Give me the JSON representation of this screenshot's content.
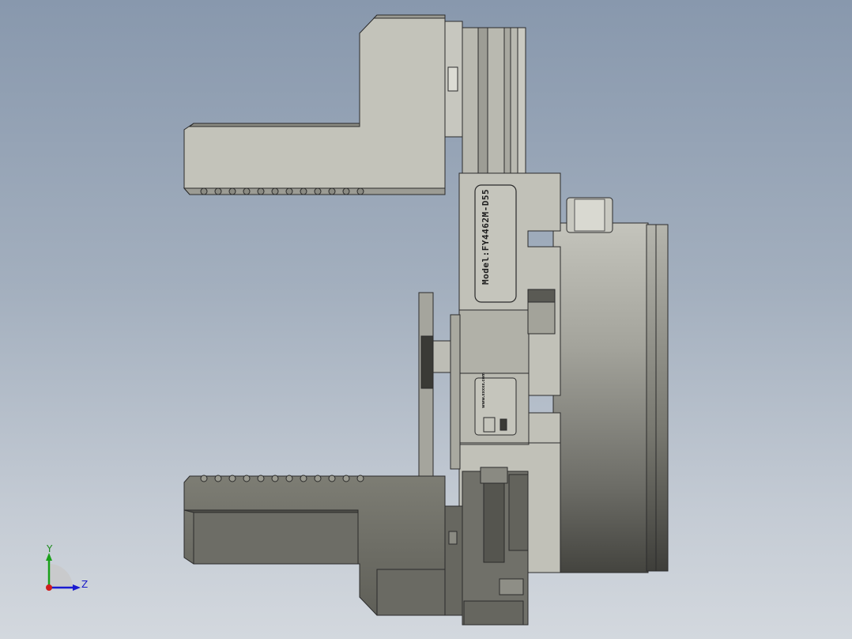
{
  "viewport": {
    "model_label": "Model:FY4462M-D55",
    "brand_url": "www.xxxxx.com"
  },
  "triad": {
    "y_label": "Y",
    "z_label": "Z",
    "colors": {
      "x": "#d01c1c",
      "y": "#1aa01a",
      "z": "#1a1ad0"
    }
  },
  "colors": {
    "background_top": "#8898ad",
    "background_bottom": "#d3d8de",
    "part_light": "#c3c3b9",
    "part_mid": "#a7a79e",
    "part_dark": "#6f6f68",
    "edge": "#2b2b2b"
  }
}
